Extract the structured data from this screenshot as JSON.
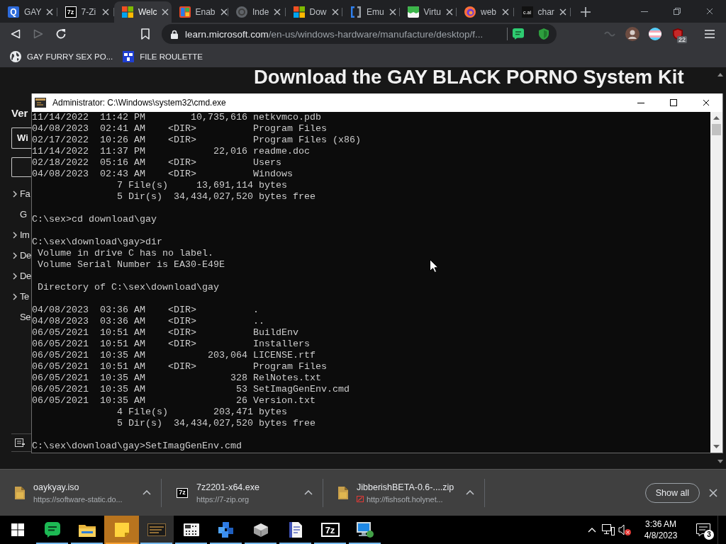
{
  "browser": {
    "tabs": [
      {
        "label": "GAY",
        "kind": "q",
        "icon_text": "Q",
        "selected": false
      },
      {
        "label": "7-Zi",
        "kind": "sevenzip",
        "icon_text": "7z",
        "selected": false
      },
      {
        "label": "Welc",
        "kind": "windows",
        "selected": true
      },
      {
        "label": "Enab",
        "kind": "tiles",
        "selected": false
      },
      {
        "label": "Inde",
        "kind": "circle",
        "selected": false
      },
      {
        "label": "Dow",
        "kind": "windows",
        "selected": false
      },
      {
        "label": "Emu",
        "kind": "bracket",
        "selected": false
      },
      {
        "label": "Virtu",
        "kind": "band",
        "selected": false
      },
      {
        "label": "web",
        "kind": "swirl",
        "selected": false
      },
      {
        "label": "char",
        "kind": "cai",
        "icon_text": "c.ai",
        "selected": false
      }
    ],
    "address": {
      "domain": "learn.microsoft.com",
      "path": "/en-us/windows-hardware/manufacture/desktop/f..."
    },
    "extension_badge": "22",
    "bookmarks": [
      {
        "label": "GAY FURRY SEX PO...",
        "kind": "globe"
      },
      {
        "label": "FILE ROULETTE",
        "kind": "tile"
      }
    ]
  },
  "page": {
    "heading": "Download the GAY BLACK PORNO System Kit",
    "sidebar": {
      "title": "Ver",
      "picker": "Wi",
      "items": [
        {
          "text": "Fa",
          "expander": true
        },
        {
          "text": "G",
          "expander": false
        },
        {
          "text": "Im",
          "expander": true
        },
        {
          "text": "De",
          "expander": true
        },
        {
          "text": "De",
          "expander": true
        },
        {
          "text": "Te",
          "expander": true
        },
        {
          "text": "Se",
          "expander": false
        }
      ]
    }
  },
  "console": {
    "title": "Administrator: C:\\Windows\\system32\\cmd.exe",
    "blocks": [
      {
        "lines": [
          "11/14/2022  11:42 PM        10,735,616 netkvmco.pdb",
          "04/08/2023  02:41 AM    <DIR>          Program Files",
          "02/17/2022  10:26 AM    <DIR>          Program Files (x86)",
          "11/14/2022  11:37 PM            22,016 readme.doc",
          "02/18/2022  05:16 AM    <DIR>          Users",
          "04/08/2023  02:43 AM    <DIR>          Windows",
          "               7 File(s)     13,691,114 bytes",
          "               5 Dir(s)  34,434,027,520 bytes free"
        ]
      },
      {
        "lines": [
          "C:\\sex>cd download\\gay"
        ]
      },
      {
        "lines": [
          "C:\\sex\\download\\gay>dir",
          " Volume in drive C has no label.",
          " Volume Serial Number is EA30-E49E"
        ]
      },
      {
        "lines": [
          " Directory of C:\\sex\\download\\gay"
        ]
      },
      {
        "lines": [
          "04/08/2023  03:36 AM    <DIR>          .",
          "04/08/2023  03:36 AM    <DIR>          ..",
          "06/05/2021  10:51 AM    <DIR>          BuildEnv",
          "06/05/2021  10:51 AM    <DIR>          Installers",
          "06/05/2021  10:35 AM           203,064 LICENSE.rtf",
          "06/05/2021  10:51 AM    <DIR>          Program Files",
          "06/05/2021  10:35 AM               328 RelNotes.txt",
          "06/05/2021  10:35 AM                53 SetImagGenEnv.cmd",
          "06/05/2021  10:35 AM                26 Version.txt",
          "               4 File(s)        203,471 bytes",
          "               5 Dir(s)  34,434,027,520 bytes free"
        ]
      },
      {
        "lines": [
          "C:\\sex\\download\\gay>SetImagGenEnv.cmd"
        ]
      }
    ]
  },
  "downloads": {
    "items": [
      {
        "file": "oaykyay.iso",
        "source": "https://software-static.do...",
        "kind": "file",
        "insecure": false
      },
      {
        "file": "7z2201-x64.exe",
        "source": "https://7-zip.org",
        "kind": "sevenzip",
        "icon_text": "7z",
        "insecure": false
      },
      {
        "file": "JibberishBETA-0.6-....zip",
        "source": "http://fishsoft.holynet...",
        "kind": "file",
        "insecure": true
      }
    ],
    "show_all": "Show all"
  },
  "taskbar": {
    "apps": [
      {
        "kind": "bubble",
        "running": true,
        "highlighted": false,
        "active": false
      },
      {
        "kind": "folder",
        "running": true,
        "highlighted": false,
        "active": false
      },
      {
        "kind": "note",
        "running": true,
        "highlighted": true,
        "active": false
      },
      {
        "kind": "console",
        "running": true,
        "highlighted": false,
        "active": true
      },
      {
        "kind": "calculator",
        "running": true,
        "highlighted": false,
        "active": false
      },
      {
        "kind": "cubes",
        "running": true,
        "highlighted": false,
        "active": false
      },
      {
        "kind": "box",
        "running": true,
        "highlighted": false,
        "active": false
      },
      {
        "kind": "document",
        "running": true,
        "highlighted": false,
        "active": false
      },
      {
        "kind": "sevenzip",
        "icon_text": "7z",
        "running": true,
        "highlighted": false,
        "active": false
      },
      {
        "kind": "computer",
        "running": true,
        "highlighted": false,
        "active": false
      }
    ],
    "clock": {
      "time": "3:36 AM",
      "date": "4/8/2023"
    },
    "notification_count": "3"
  }
}
